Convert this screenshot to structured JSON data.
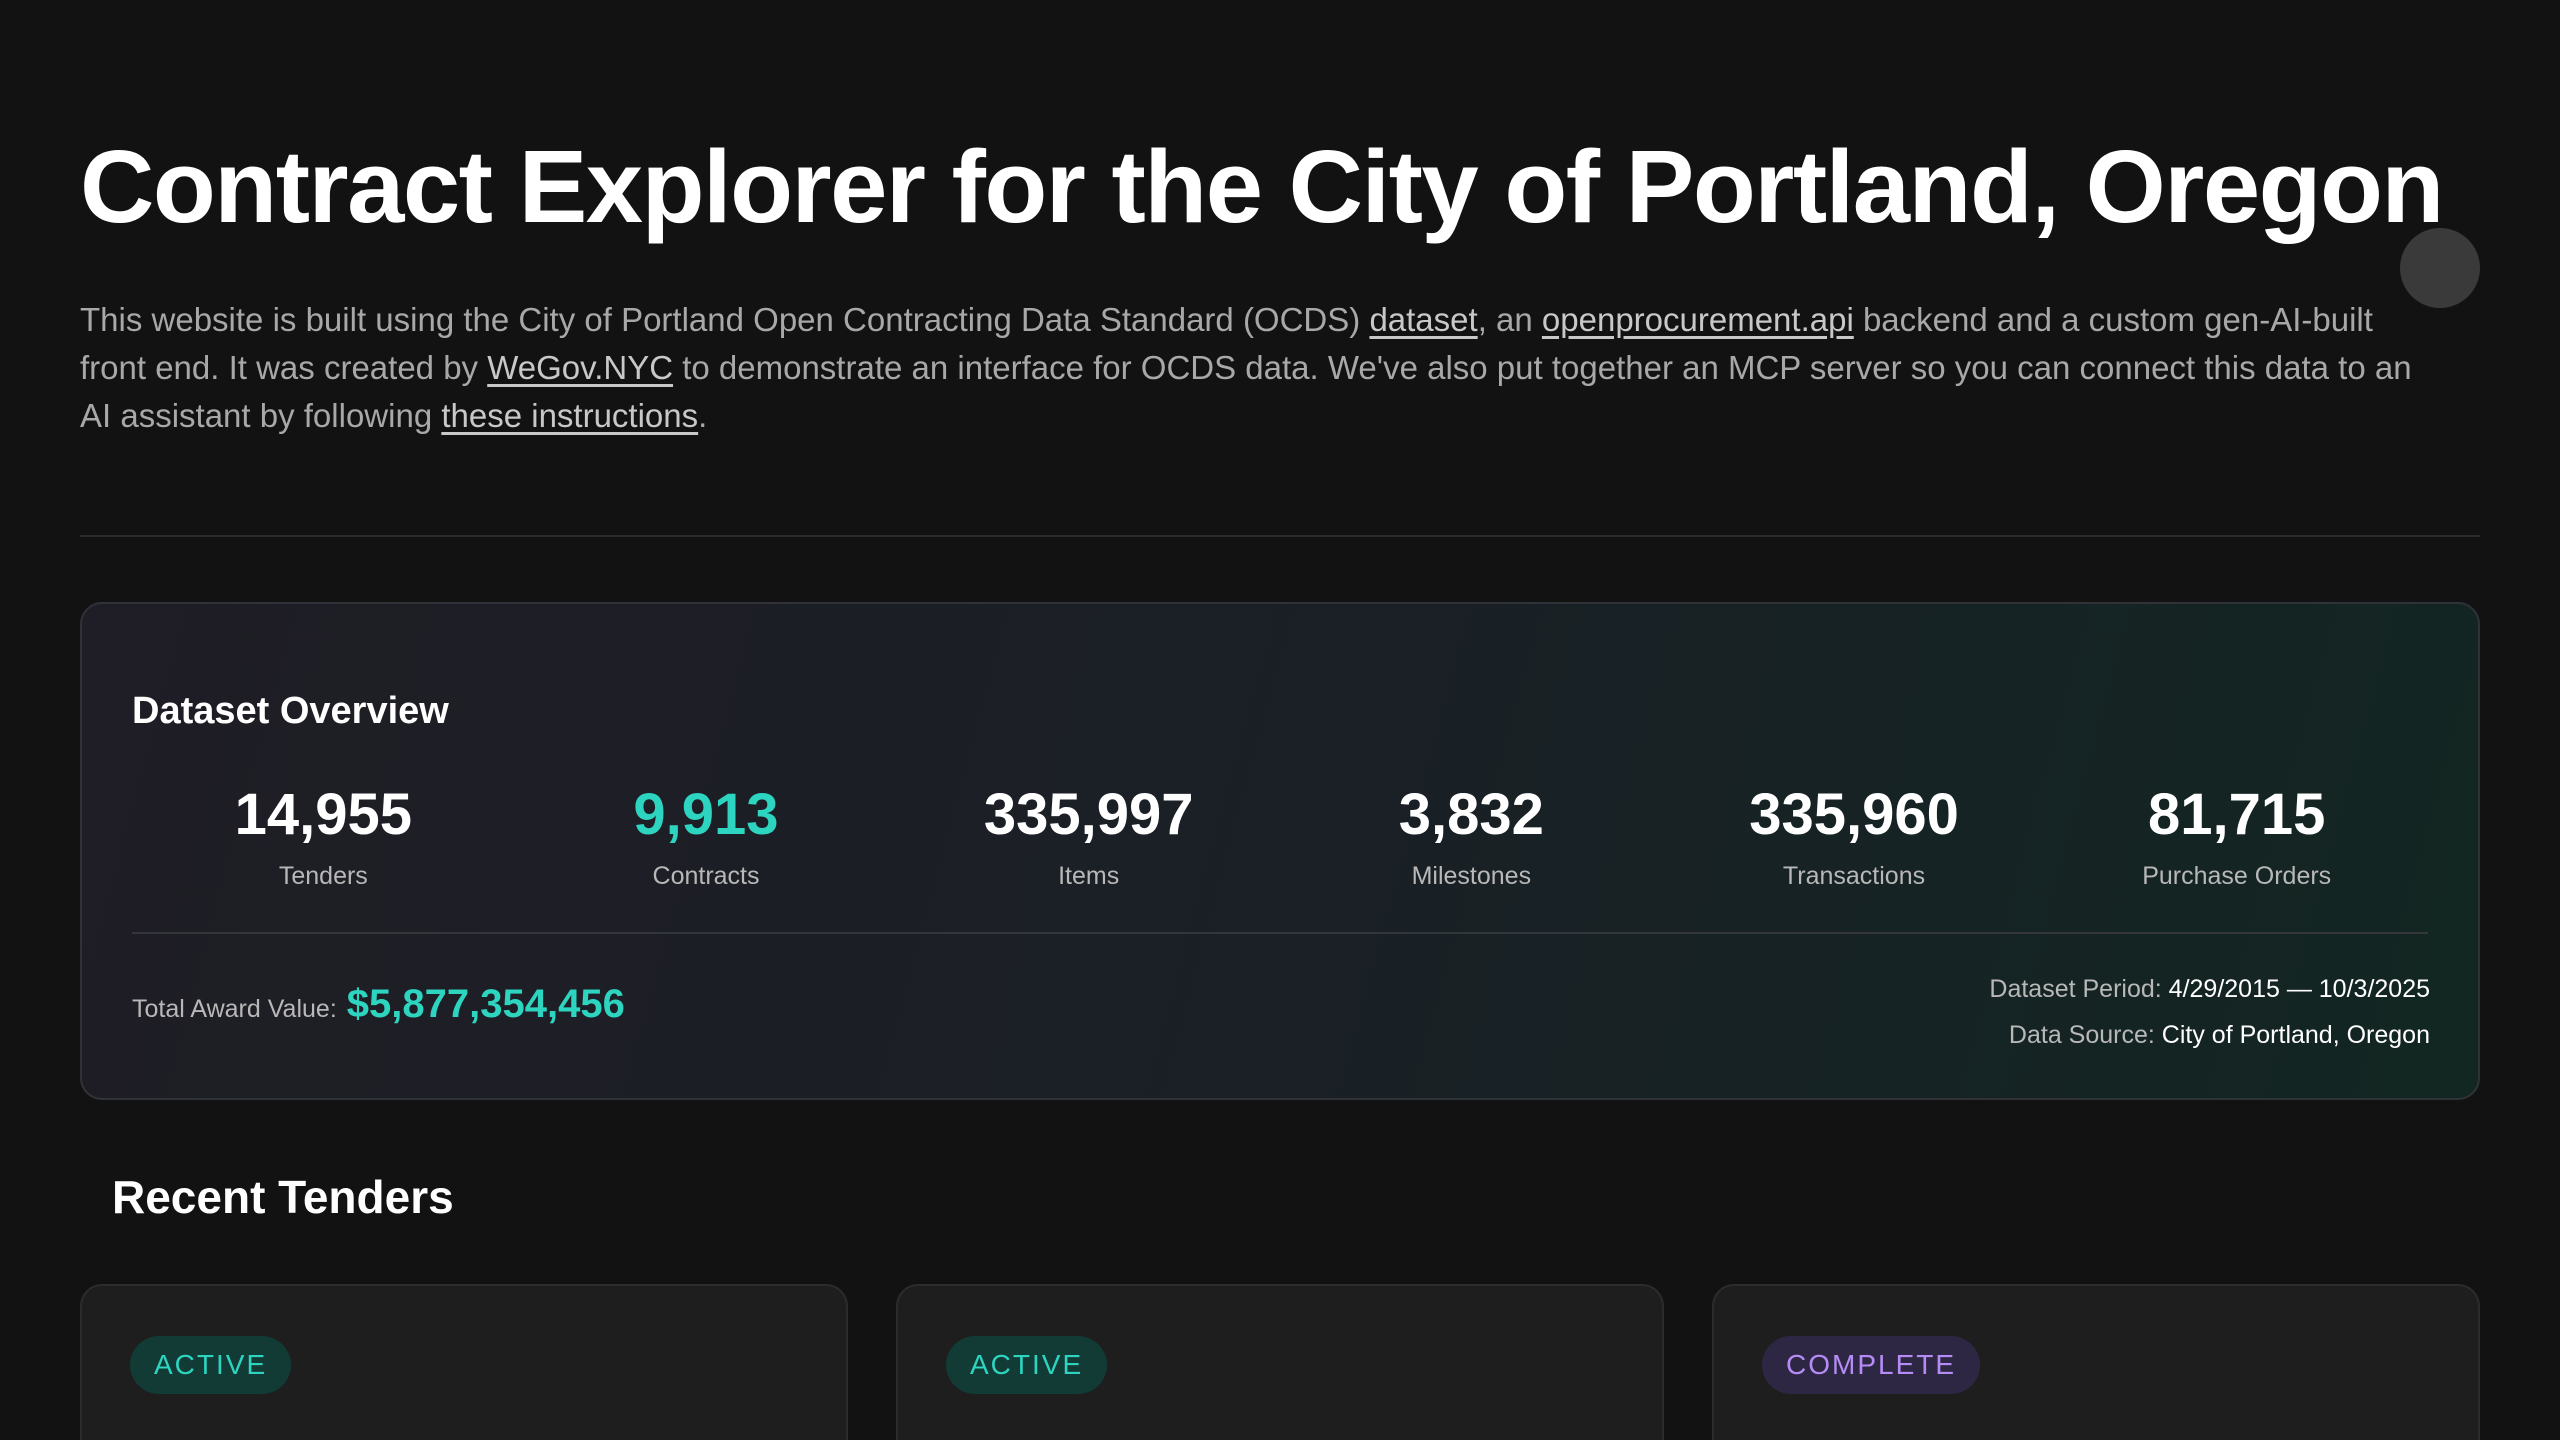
{
  "header": {
    "title": "Contract Explorer for the City of Portland, Oregon"
  },
  "intro": {
    "text_1": "This website is built using the City of Portland Open Contracting Data Standard (OCDS) ",
    "link_dataset": "dataset",
    "text_2": ", an ",
    "link_api": "openprocurement.api",
    "text_3": " backend and a custom gen-AI-built front end. It was created by ",
    "link_wegov": "WeGov.NYC",
    "text_4": " to demonstrate an interface for OCDS data. We've also put together an MCP server so you can connect this data to an AI assistant by following ",
    "link_instructions": "these instructions",
    "text_5": "."
  },
  "overview": {
    "title": "Dataset Overview",
    "stats": [
      {
        "value": "14,955",
        "label": "Tenders"
      },
      {
        "value": "9,913",
        "label": "Contracts"
      },
      {
        "value": "335,997",
        "label": "Items"
      },
      {
        "value": "3,832",
        "label": "Milestones"
      },
      {
        "value": "335,960",
        "label": "Transactions"
      },
      {
        "value": "81,715",
        "label": "Purchase Orders"
      }
    ],
    "award_label": "Total Award Value:",
    "award_value": "$5,877,354,456",
    "period_label": "Dataset Period:",
    "period_value": "4/29/2015 — 10/3/2025",
    "source_label": "Data Source:",
    "source_value": "City of Portland, Oregon"
  },
  "recent": {
    "title": "Recent Tenders",
    "cards": [
      {
        "status": "ACTIVE"
      },
      {
        "status": "ACTIVE"
      },
      {
        "status": "COMPLETE"
      }
    ]
  },
  "colors": {
    "background": "#121212",
    "accent": "#2dd4bf",
    "complete": "#b58cf5"
  }
}
